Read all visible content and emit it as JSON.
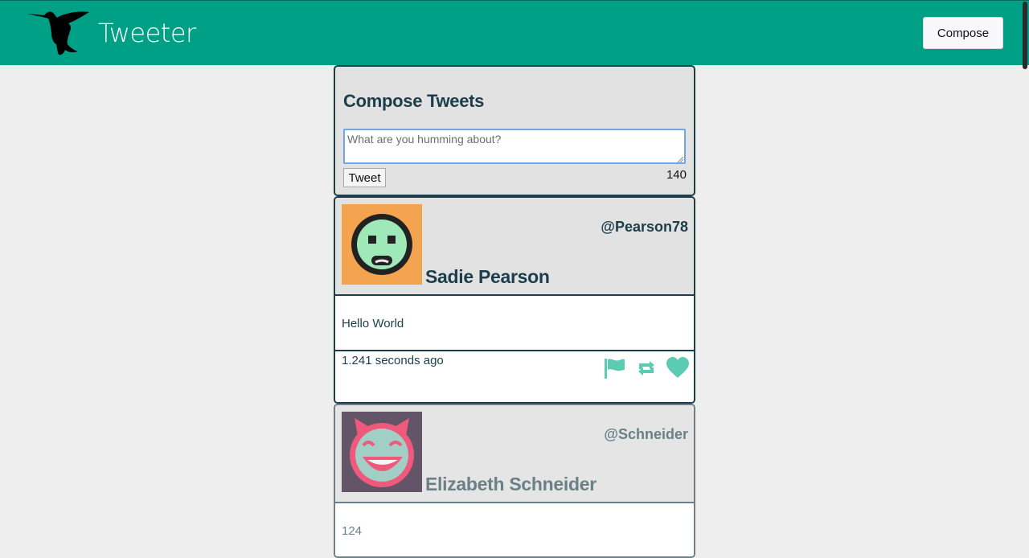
{
  "nav": {
    "brand": "Tweeter",
    "compose_label": "Compose",
    "logo_icon": "hummingbird-icon",
    "background": "#00a087"
  },
  "compose": {
    "title": "Compose Tweets",
    "placeholder": "What are you humming about?",
    "value": "",
    "tweet_label": "Tweet",
    "counter": "140"
  },
  "tweets": [
    {
      "name": "Sadie Pearson",
      "handle": "@Pearson78",
      "text": "Hello World",
      "timestamp": "1.241 seconds ago",
      "avatar_icon": "green-face-avatar",
      "actions": [
        "flag-icon",
        "retweet-icon",
        "heart-icon"
      ]
    },
    {
      "name": "Elizabeth Schneider",
      "handle": "@Schneider",
      "text": "124",
      "avatar_icon": "laughing-devil-avatar"
    }
  ],
  "colors": {
    "accent": "#00a087",
    "text_dark": "#1c3d4a",
    "action_icons": "#5ccbb4"
  }
}
